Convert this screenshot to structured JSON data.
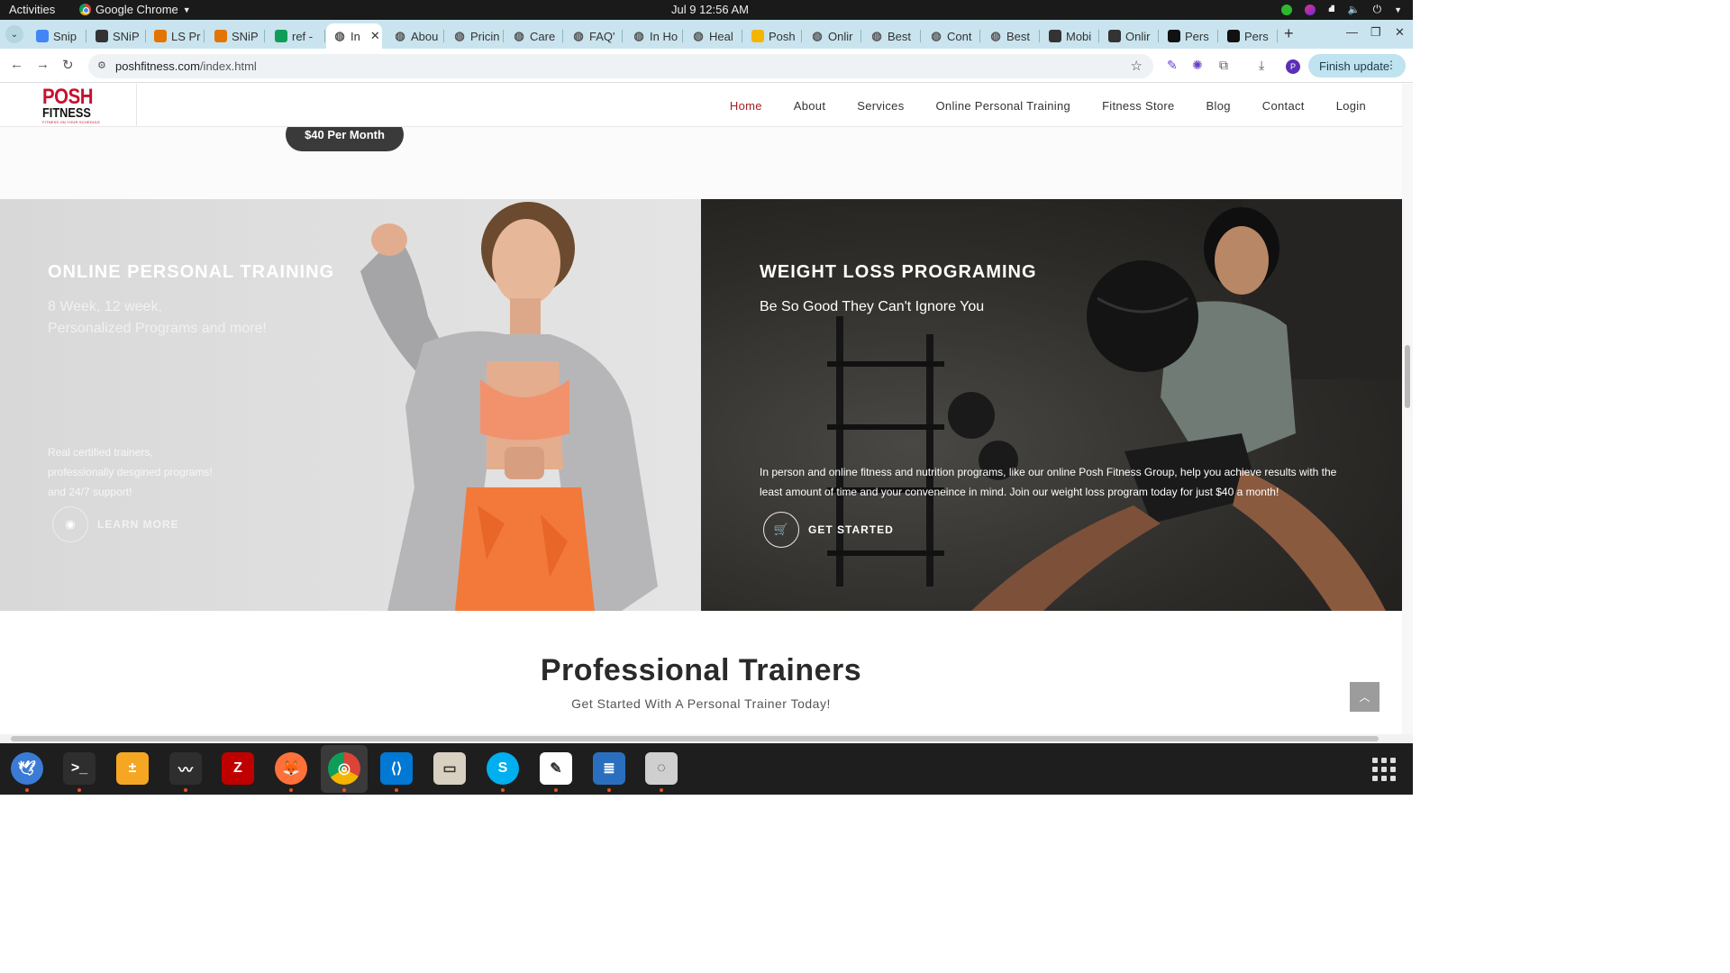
{
  "topbar": {
    "activities": "Activities",
    "app_name": "Google Chrome",
    "clock": "Jul 9  12:56 AM"
  },
  "tabs": [
    {
      "label": "Snip",
      "icon": "google-docs-icon",
      "color": "#4285f4"
    },
    {
      "label": "SNiP",
      "icon": "snip-logo-icon",
      "color": "#333333"
    },
    {
      "label": "LS Pr",
      "icon": "ls-logo-icon",
      "color": "#e37400"
    },
    {
      "label": "SNiP",
      "icon": "snip-ls-icon",
      "color": "#e37400"
    },
    {
      "label": "ref -",
      "icon": "google-sheets-icon",
      "color": "#0f9d58"
    },
    {
      "label": "In",
      "icon": "globe-icon",
      "color": "#555555",
      "active": true
    },
    {
      "label": "Abou",
      "icon": "globe-icon",
      "color": "#555555"
    },
    {
      "label": "Pricin",
      "icon": "globe-icon",
      "color": "#555555"
    },
    {
      "label": "Care",
      "icon": "globe-icon",
      "color": "#555555"
    },
    {
      "label": "FAQ'",
      "icon": "globe-icon",
      "color": "#555555"
    },
    {
      "label": "In Ho",
      "icon": "globe-icon",
      "color": "#555555"
    },
    {
      "label": "Heal",
      "icon": "globe-icon",
      "color": "#555555"
    },
    {
      "label": "Posh",
      "icon": "t-logo-icon",
      "color": "#f4b400"
    },
    {
      "label": "Onlir",
      "icon": "globe-icon",
      "color": "#555555"
    },
    {
      "label": "Best",
      "icon": "globe-icon",
      "color": "#555555"
    },
    {
      "label": "Cont",
      "icon": "globe-icon",
      "color": "#555555"
    },
    {
      "label": "Best",
      "icon": "globe-icon",
      "color": "#555555"
    },
    {
      "label": "Mobi",
      "icon": "a-logo-icon",
      "color": "#333333"
    },
    {
      "label": "Onlir",
      "icon": "a-logo-icon",
      "color": "#333333"
    },
    {
      "label": "Pers",
      "icon": "fs-logo-icon",
      "color": "#111111"
    },
    {
      "label": "Pers",
      "icon": "fs-logo-icon",
      "color": "#111111"
    }
  ],
  "address_bar": {
    "domain": "poshfitness.com",
    "path": "/index.html"
  },
  "browser": {
    "finish_update": "Finish update",
    "profile_initial": "P"
  },
  "site": {
    "logo_line1": "POSH",
    "logo_line2": "FITNESS",
    "logo_tagline": "FITNESS ON YOUR SCHEDULE",
    "nav": [
      "Home",
      "About",
      "Services",
      "Online Personal Training",
      "Fitness Store",
      "Blog",
      "Contact",
      "Login"
    ],
    "nav_active": "Home",
    "brand_color": "#a31e22"
  },
  "content": {
    "price_button": "$40 Per Month",
    "left_panel": {
      "title": "ONLINE PERSONAL TRAINING",
      "sub_line1": "8 Week, 12 week,",
      "sub_line2": "Personalized Programs and more!",
      "body_line1": "Real certified trainers,",
      "body_line2": "professionally desgined programs!",
      "body_line3": "and 24/7 support!",
      "cta": "LEARN MORE",
      "cta_icon": "camera-icon"
    },
    "right_panel": {
      "title": "WEIGHT LOSS PROGRAMING",
      "subtitle": "Be So Good They Can't Ignore You",
      "body_line1": "In person and online fitness and nutrition programs, like our online Posh Fitness Group, help you achieve results with the",
      "body_line2": "least amount of time and your conveneince in mind. Join our weight loss program today for just $40 a month!",
      "cta": "GET STARTED",
      "cta_icon": "cart-icon"
    },
    "trainers_title": "Professional Trainers",
    "trainers_sub": "Get Started With A Personal Trainer Today!"
  },
  "dock": [
    {
      "name": "thunderbird-icon",
      "color": "#3a7bd5"
    },
    {
      "name": "terminal-icon",
      "color": "#2e2e2e"
    },
    {
      "name": "calculator-icon",
      "color": "#f5a623"
    },
    {
      "name": "system-monitor-icon",
      "color": "#2e2e2e"
    },
    {
      "name": "filezilla-icon",
      "color": "#bf0000"
    },
    {
      "name": "firefox-icon",
      "color": "#ff7139"
    },
    {
      "name": "chrome-icon",
      "color": "#4285f4"
    },
    {
      "name": "vscode-icon",
      "color": "#0078d4"
    },
    {
      "name": "files-icon",
      "color": "#d8d0c0"
    },
    {
      "name": "skype-icon",
      "color": "#00aff0"
    },
    {
      "name": "text-editor-icon",
      "color": "#ffffff"
    },
    {
      "name": "libreoffice-writer-icon",
      "color": "#2a6fbf"
    },
    {
      "name": "disk-utility-icon",
      "color": "#cfcfcf"
    }
  ]
}
